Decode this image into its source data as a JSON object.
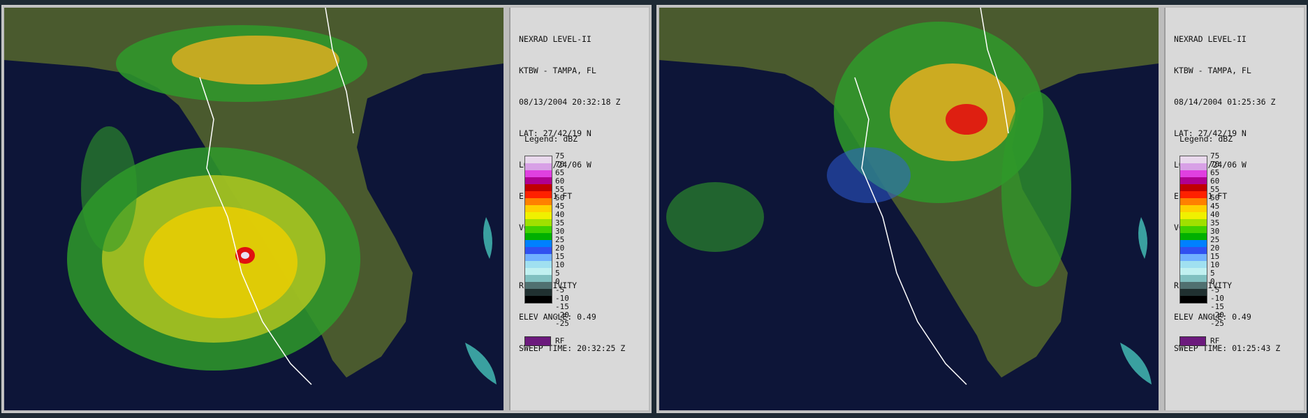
{
  "panels": [
    {
      "product": "NEXRAD LEVEL-II",
      "station": "KTBW - TAMPA, FL",
      "datetime": "08/13/2004 20:32:18 Z",
      "lat": "LAT: 27/42/19 N",
      "lon": "LON: 82/24/06 W",
      "elev": "ELEV: 41 FT",
      "vcp": "VCP: 11",
      "moment": "REFLECTIVITY",
      "elev_angle": "ELEV ANGLE: 0.49",
      "sweep_time": "SWEEP TIME: 20:32:25 Z"
    },
    {
      "product": "NEXRAD LEVEL-II",
      "station": "KTBW - TAMPA, FL",
      "datetime": "08/14/2004 01:25:36 Z",
      "lat": "LAT: 27/42/19 N",
      "lon": "LON: 82/24/06 W",
      "elev": "ELEV: 41 FT",
      "vcp": "VCP: 11",
      "moment": "REFLECTIVITY",
      "elev_angle": "ELEV ANGLE: 0.49",
      "sweep_time": "SWEEP TIME: 01:25:43 Z"
    }
  ],
  "legend": {
    "title": "Legend: dBZ",
    "ticks": [
      "75",
      "70",
      "65",
      "60",
      "55",
      "50",
      "45",
      "40",
      "35",
      "30",
      "25",
      "20",
      "15",
      "10",
      "5",
      "0",
      "-5",
      "-10",
      "-15",
      "-20",
      "-25"
    ],
    "colors": [
      "#e8d8ec",
      "#d8a0e6",
      "#e040e0",
      "#b00090",
      "#c00000",
      "#ff2000",
      "#ff8000",
      "#ffd000",
      "#f0f000",
      "#a0e000",
      "#40d000",
      "#00b000",
      "#0080ff",
      "#3050f0",
      "#70b0ff",
      "#a0e0f0",
      "#c0f0f0",
      "#80c0c0",
      "#507070",
      "#203030",
      "#000000"
    ],
    "rf_label": "RF",
    "rf_color": "#6c1a7d"
  }
}
